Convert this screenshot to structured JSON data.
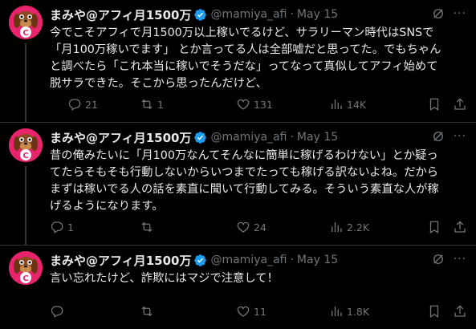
{
  "tweets": [
    {
      "name": "まみや@アフィ月1500万",
      "handle": "@mamiya_afi",
      "dot": "·",
      "time": "May 15",
      "text": "今でこそアフィで月1500万以上稼いでるけど、サラリーマン時代はSNSで\n「月100万稼いでます」 とか言ってる人は全部嘘だと思ってた。でもちゃん\nと調べたら「これ本当に稼いでそうだな」ってなって真似してアフィ始めて\n脱サラできた。そこから思ったんだけど、",
      "replies": "21",
      "reposts": "1",
      "likes": "131",
      "views": "14K"
    },
    {
      "name": "まみや@アフィ月1500万",
      "handle": "@mamiya_afi",
      "dot": "·",
      "time": "May 15",
      "text": "昔の俺みたいに「月100万なんてそんなに簡単に稼げるわけない」とか疑っ\nてたらそもそも行動しないからいつまでたっても稼げる訳ないよね。だから\nまずは稼いでる人の話を素直に聞いて行動してみる。そういう素直な人が稼\nげるようになります。",
      "replies": "1",
      "reposts": "",
      "likes": "24",
      "views": "2.2K"
    },
    {
      "name": "まみや@アフィ月1500万",
      "handle": "@mamiya_afi",
      "dot": "·",
      "time": "May 15",
      "text": "言い忘れたけど、詐欺にはマジで注意して！",
      "replies": "",
      "reposts": "",
      "likes": "11",
      "views": "1.8K"
    }
  ],
  "icons": {
    "verified": "verified-badge-icon",
    "grok": "grok-icon",
    "more": "more-icon",
    "reply": "reply-icon",
    "repost": "repost-icon",
    "like": "heart-icon",
    "views": "views-icon",
    "bookmark": "bookmark-icon",
    "share": "share-icon"
  },
  "colors": {
    "background": "#000000",
    "text": "#e7e9ea",
    "muted": "#71767b",
    "verified": "#1d9bf0",
    "avatar_bg": "#e7246c"
  },
  "more_glyph": "···"
}
